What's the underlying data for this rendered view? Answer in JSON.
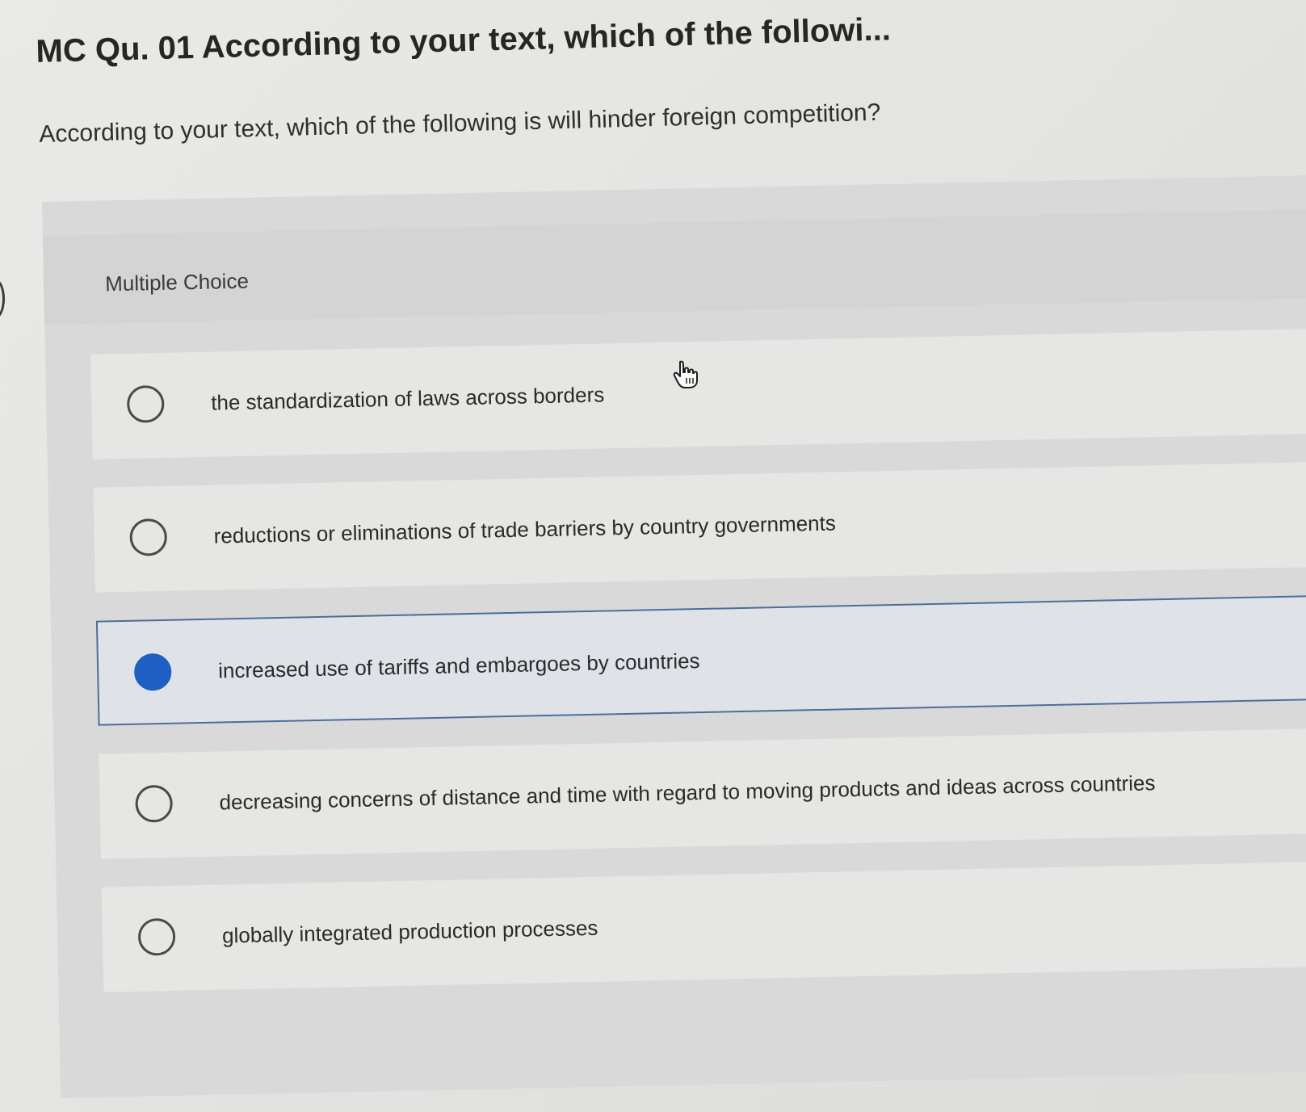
{
  "question": {
    "title": "MC Qu. 01 According to your text, which of the followi...",
    "prompt": "According to your text, which of the following is will hinder foreign competition?"
  },
  "choice_panel": {
    "type_label": "Multiple Choice",
    "options": [
      {
        "label": "the standardization of laws across borders",
        "selected": false
      },
      {
        "label": "reductions or eliminations of trade barriers by country governments",
        "selected": false
      },
      {
        "label": "increased use of tariffs and embargoes by countries",
        "selected": true
      },
      {
        "label": "decreasing concerns of distance and time with regard to moving products and ideas across countries",
        "selected": false
      },
      {
        "label": "globally integrated production processes",
        "selected": false
      }
    ]
  },
  "colors": {
    "selected_accent": "#1f5fc4",
    "selected_border": "#4a6e9a"
  },
  "icons": {
    "cursor": "hand-pointer-icon"
  }
}
